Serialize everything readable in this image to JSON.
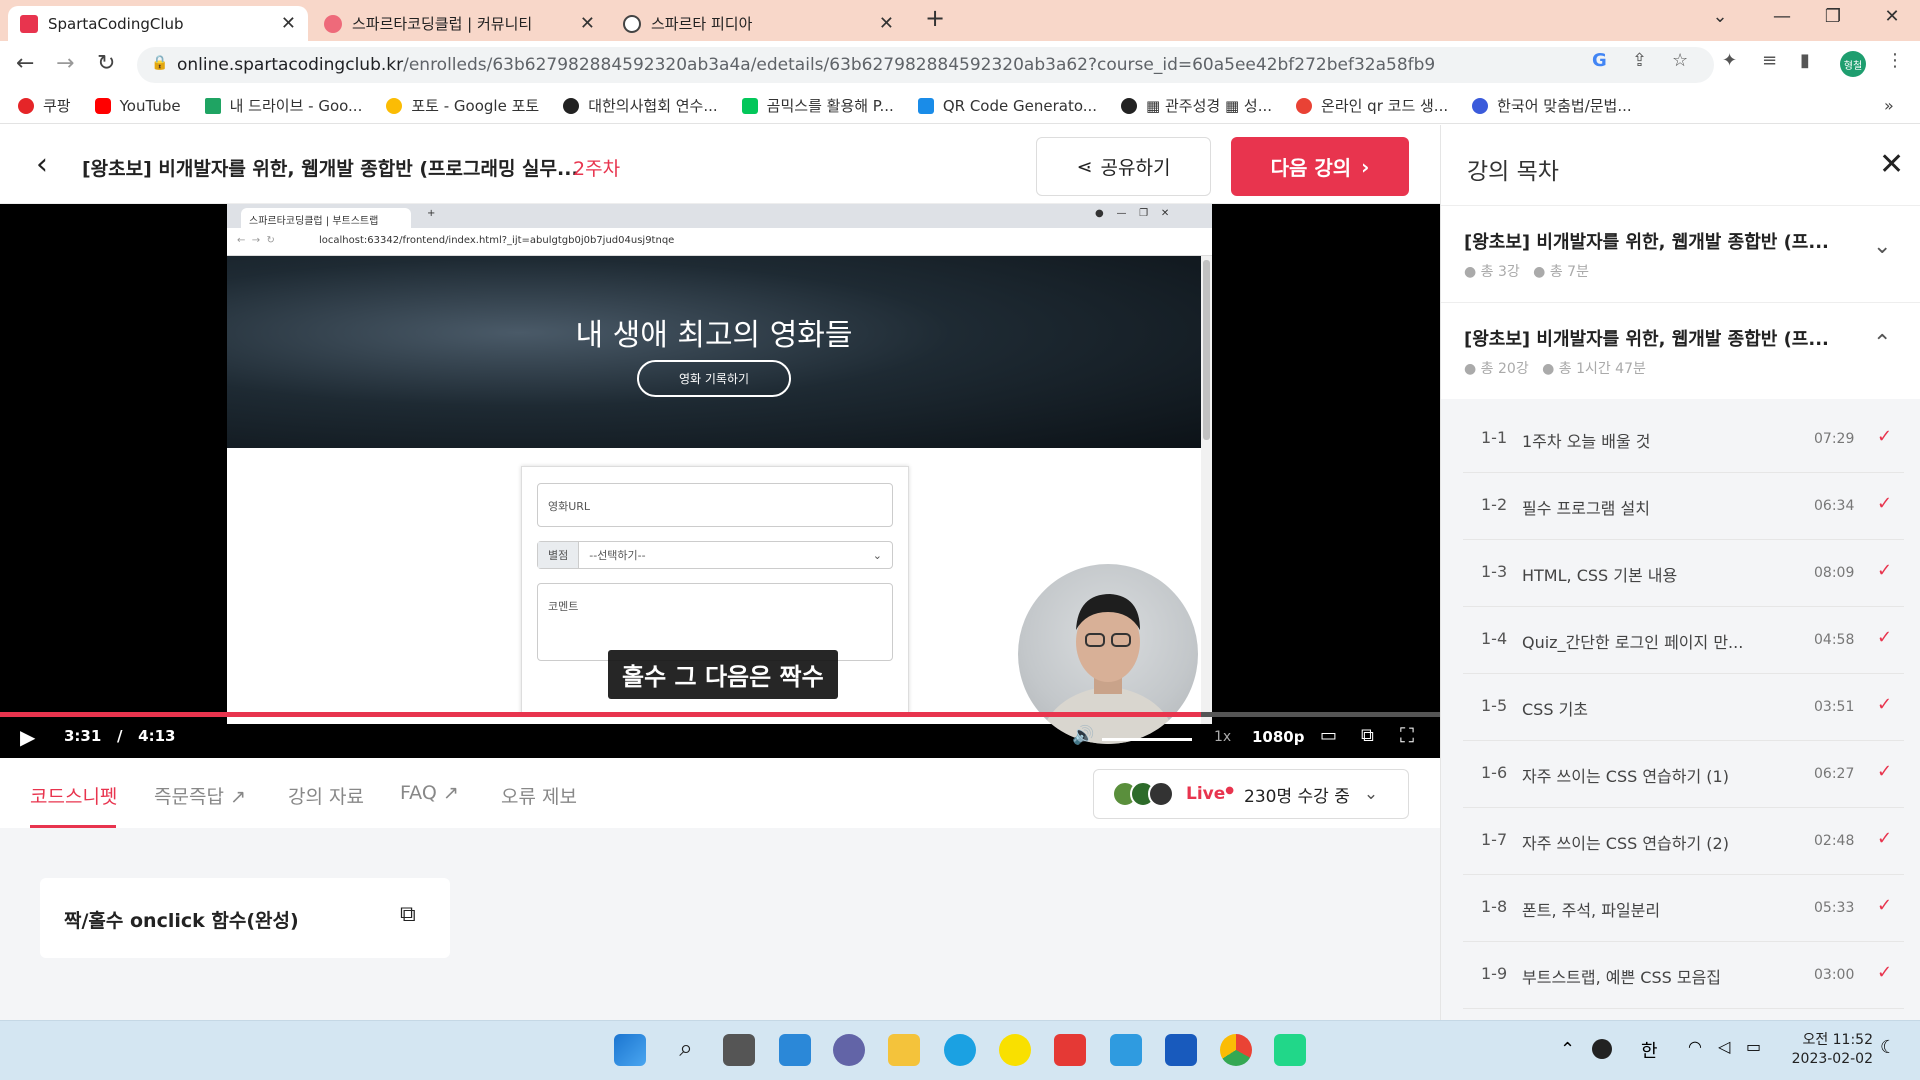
{
  "browser": {
    "tabs": [
      {
        "title": "SpartaCodingClub",
        "active": true
      },
      {
        "title": "스파르타코딩클럽 | 커뮤니티",
        "active": false
      },
      {
        "title": "스파르타 피디아",
        "active": false
      }
    ],
    "url_host": "online.spartacodingclub.kr",
    "url_path": "/enrolleds/63b627982884592320ab3a4a/edetails/63b627982884592320ab3a62?course_id=60a5ee42bf272bef32a58fb9",
    "profile_label": "형철",
    "bookmarks": [
      {
        "label": "쿠팡",
        "color": "#e52528"
      },
      {
        "label": "YouTube",
        "color": "#ff0000"
      },
      {
        "label": "내 드라이브 - Goo...",
        "color": "#1fa463"
      },
      {
        "label": "포토 - Google 포토",
        "color": "#fbbc04"
      },
      {
        "label": "대한의사협회 연수...",
        "color": "#222222"
      },
      {
        "label": "곰믹스를 활용해 P...",
        "color": "#03c75a"
      },
      {
        "label": "QR Code Generato...",
        "color": "#1a8ce8"
      },
      {
        "label": "▦ 관주성경 ▦ 성...",
        "color": "#222222"
      },
      {
        "label": "온라인 qr 코드 생...",
        "color": "#e94235"
      },
      {
        "label": "한국어 맞춤법/문법...",
        "color": "#3b5bdb"
      }
    ]
  },
  "header": {
    "course_title": "[왕초보] 비개발자를 위한, 웹개발 종합반 (프로그래밍 실무...",
    "week": "2주차",
    "share_label": "공유하기",
    "next_label": "다음 강의"
  },
  "video": {
    "inner_tab_title": "스파르타코딩클럽 | 부트스트랩",
    "inner_url": "localhost:63342/frontend/index.html?_ijt=abulgtgb0j0b7jud04usj9tnqe",
    "hero_title": "내 생애 최고의 영화들",
    "hero_button": "영화 기록하기",
    "form_url_placeholder": "영화URL",
    "form_rating_label": "별점",
    "form_rating_value": "--선택하기--",
    "form_comment_placeholder": "코멘트",
    "subtitle": "홀수 그 다음은 짝수",
    "current_time": "3:31",
    "time_separator": "/",
    "duration": "4:13",
    "progress_fraction": 0.834,
    "speed": "1x",
    "quality": "1080p"
  },
  "content_tabs": [
    {
      "label": "코드스니펫",
      "active": true
    },
    {
      "label": "즉문즉답 ↗",
      "active": false
    },
    {
      "label": "강의 자료",
      "active": false
    },
    {
      "label": "FAQ ↗",
      "active": false
    },
    {
      "label": "오류 제보",
      "active": false
    }
  ],
  "live": {
    "badge": "Live",
    "count_text": "230명 수강 중"
  },
  "snippet": {
    "title": "짝/홀수 onclick 함수(완성)"
  },
  "sidebar": {
    "title": "강의 목차",
    "sections": [
      {
        "title": "[왕초보] 비개발자를 위한, 웹개발 종합반 (프...",
        "lectures": "총 3강",
        "duration": "총 7분",
        "expanded": false
      },
      {
        "title": "[왕초보] 비개발자를 위한, 웹개발 종합반 (프...",
        "lectures": "총 20강",
        "duration": "총 1시간 47분",
        "expanded": true
      }
    ],
    "lessons": [
      {
        "num": "1-1",
        "title": "1주차 오늘 배울 것",
        "time": "07:29"
      },
      {
        "num": "1-2",
        "title": "필수 프로그램 설치",
        "time": "06:34"
      },
      {
        "num": "1-3",
        "title": "HTML, CSS 기본 내용",
        "time": "08:09"
      },
      {
        "num": "1-4",
        "title": "Quiz_간단한 로그인 페이지 만...",
        "time": "04:58"
      },
      {
        "num": "1-5",
        "title": "CSS 기초",
        "time": "03:51"
      },
      {
        "num": "1-6",
        "title": "자주 쓰이는 CSS 연습하기 (1)",
        "time": "06:27"
      },
      {
        "num": "1-7",
        "title": "자주 쓰이는 CSS 연습하기 (2)",
        "time": "02:48"
      },
      {
        "num": "1-8",
        "title": "폰트, 주석, 파일분리",
        "time": "05:33"
      },
      {
        "num": "1-9",
        "title": "부트스트랩, 예쁜 CSS 모음집",
        "time": "03:00"
      }
    ]
  },
  "taskbar": {
    "ime": "한",
    "time": "오전 11:52",
    "date": "2023-02-02"
  },
  "colors": {
    "accent": "#e8344e"
  }
}
